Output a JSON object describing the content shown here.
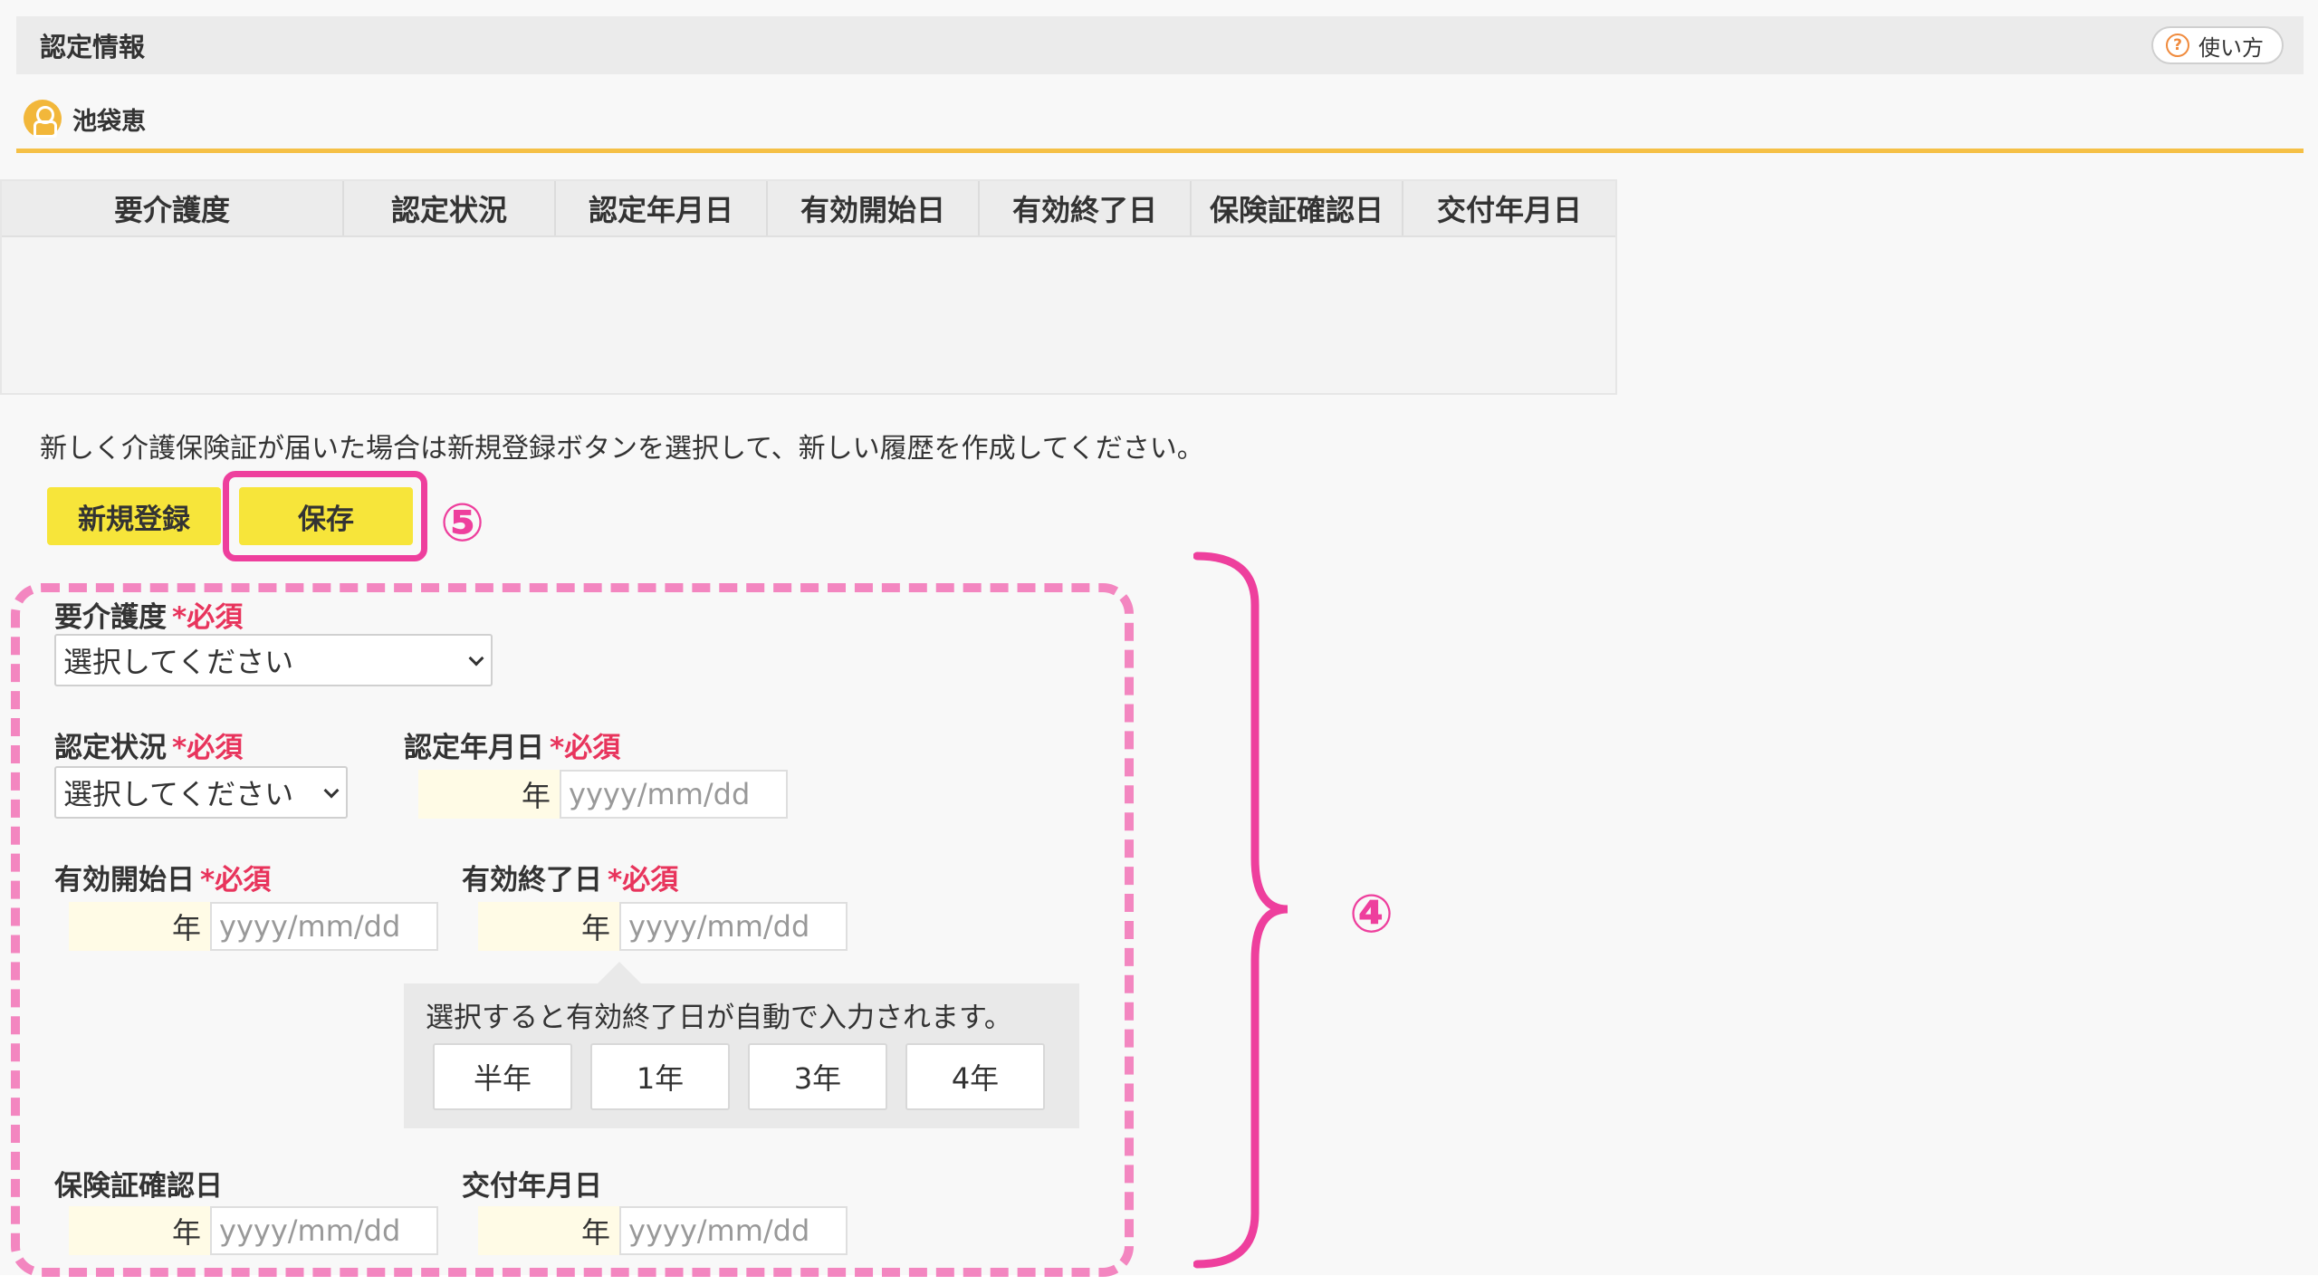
{
  "header": {
    "title": "認定情報",
    "help_label": "使い方",
    "help_icon": "question-circle-icon"
  },
  "user": {
    "name": "池袋恵",
    "icon": "person-icon"
  },
  "history_table": {
    "columns": [
      "要介護度",
      "認定状況",
      "認定年月日",
      "有効開始日",
      "有効終了日",
      "保険証確認日",
      "交付年月日"
    ],
    "rows": []
  },
  "notice": "新しく介護保険証が届いた場合は新規登録ボタンを選択して、新しい履歴を作成してください。",
  "buttons": {
    "new_label": "新規登録",
    "save_label": "保存"
  },
  "annotations": {
    "save": "⑤",
    "form": "④"
  },
  "form": {
    "required_mark": "*必須",
    "care_level": {
      "label": "要介護度",
      "value": "選択してください"
    },
    "cert_status": {
      "label": "認定状況",
      "value": "選択してください"
    },
    "cert_date": {
      "label": "認定年月日",
      "year_suffix": "年",
      "placeholder": "yyyy/mm/dd"
    },
    "valid_start": {
      "label": "有効開始日",
      "year_suffix": "年",
      "placeholder": "yyyy/mm/dd"
    },
    "valid_end": {
      "label": "有効終了日",
      "year_suffix": "年",
      "placeholder": "yyyy/mm/dd"
    },
    "insurance_check": {
      "label": "保険証確認日",
      "year_suffix": "年",
      "placeholder": "yyyy/mm/dd"
    },
    "issue_date": {
      "label": "交付年月日",
      "year_suffix": "年",
      "placeholder": "yyyy/mm/dd"
    },
    "duration_popup": {
      "text": "選択すると有効終了日が自動で入力されます。",
      "options": [
        "半年",
        "1年",
        "3年",
        "4年"
      ]
    }
  },
  "colors": {
    "accent_yellow": "#f7e53a",
    "annotation_pink": "#ee3f9d",
    "required_red": "#e8345c",
    "header_line": "#f5c046"
  }
}
